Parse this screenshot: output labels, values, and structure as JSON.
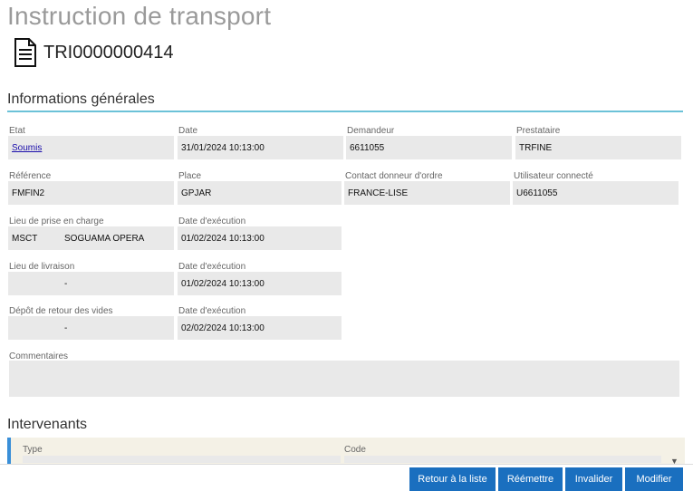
{
  "page": {
    "title": "Instruction de transport",
    "reference": "TRI0000000414"
  },
  "general": {
    "title": "Informations générales",
    "etat": {
      "label": "Etat",
      "value": "Soumis"
    },
    "date": {
      "label": "Date",
      "value": "31/01/2024 10:13:00"
    },
    "demandeur": {
      "label": "Demandeur",
      "value": "6611055"
    },
    "prestataire": {
      "label": "Prestataire",
      "value": "TRFINE"
    },
    "reference": {
      "label": "Référence",
      "value": "FMFIN2"
    },
    "place": {
      "label": "Place",
      "value": "GPJAR"
    },
    "contact": {
      "label": "Contact donneur d'ordre",
      "value": "FRANCE-LISE"
    },
    "user": {
      "label": "Utilisateur connecté",
      "value": "U6611055"
    },
    "pickup": {
      "label": "Lieu de prise en charge",
      "code": "MSCT",
      "name": "SOGUAMA OPERA",
      "date_label": "Date d'exécution",
      "date": "01/02/2024 10:13:00"
    },
    "delivery": {
      "label": "Lieu de livraison",
      "name": "-",
      "date_label": "Date d'exécution",
      "date": "01/02/2024 10:13:00"
    },
    "empty_return": {
      "label": "Dépôt de retour des vides",
      "name": "-",
      "date_label": "Date d'exécution",
      "date": "02/02/2024 10:13:00"
    },
    "comments": {
      "label": "Commentaires",
      "value": ""
    }
  },
  "intervenants": {
    "title": "Intervenants",
    "col_type": "Type",
    "col_code": "Code"
  },
  "actions": {
    "back": "Retour à la liste",
    "resend": "Réémettre",
    "invalidate": "Invalider",
    "modify": "Modifier"
  },
  "colors": {
    "accent": "#1a6fbf",
    "section_line": "#6cc2d8",
    "field_bg": "#e9e9e9",
    "panel_bg": "#f4f1e6",
    "panel_marker": "#3a8fd8"
  },
  "icons": {
    "document": "document-icon",
    "scroll_down": "chevron-down-icon"
  }
}
